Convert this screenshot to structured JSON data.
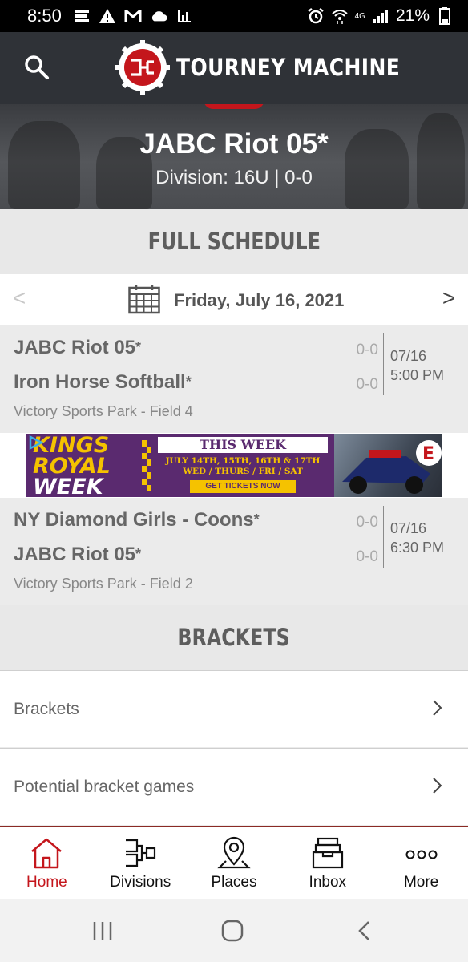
{
  "status_bar": {
    "time": "8:50",
    "network": "4G",
    "battery": "21%"
  },
  "header": {
    "brand": "TOURNEY MACHINE",
    "brand_color": "#c4161c",
    "icons": [
      "search-icon",
      "tourney-machine-logo"
    ]
  },
  "team": {
    "name": "JABC Riot 05*",
    "subtitle": "Division: 16U | 0-0"
  },
  "schedule": {
    "heading": "FULL SCHEDULE",
    "prev": "<",
    "next": ">",
    "date": "Friday, July 16, 2021",
    "games": [
      {
        "team1": "JABC Riot 05",
        "team1_star": "*",
        "score1": "0-0",
        "team2": "Iron Horse Softball",
        "team2_star": "*",
        "score2": "0-0",
        "date": "07/16",
        "time": "5:00 PM",
        "venue": "Victory Sports Park - Field 4"
      },
      {
        "team1": "NY Diamond Girls - Coons",
        "team1_star": "*",
        "score1": "0-0",
        "team2": "JABC Riot 05",
        "team2_star": "*",
        "score2": "0-0",
        "date": "07/16",
        "time": "6:30 PM",
        "venue": "Victory Sports Park - Field 2"
      }
    ]
  },
  "ad": {
    "line1": "KINGS",
    "line2": "ROYAL",
    "line3": "WEEK",
    "this_week": "THIS WEEK",
    "dates": "JULY 14TH, 15TH, 16TH & 17TH",
    "days": "WED / THURS / FRI / SAT",
    "cta": "GET TICKETS NOW"
  },
  "brackets": {
    "heading": "BRACKETS",
    "items": [
      {
        "label": "Brackets"
      },
      {
        "label": "Potential bracket games"
      }
    ]
  },
  "tabs": [
    {
      "label": "Home",
      "icon": "home-icon",
      "active": true
    },
    {
      "label": "Divisions",
      "icon": "bracket-icon",
      "active": false
    },
    {
      "label": "Places",
      "icon": "map-pin-icon",
      "active": false
    },
    {
      "label": "Inbox",
      "icon": "inbox-icon",
      "active": false
    },
    {
      "label": "More",
      "icon": "more-icon",
      "active": false
    }
  ],
  "android_nav": [
    "recents-icon",
    "home-circle-icon",
    "back-icon"
  ]
}
